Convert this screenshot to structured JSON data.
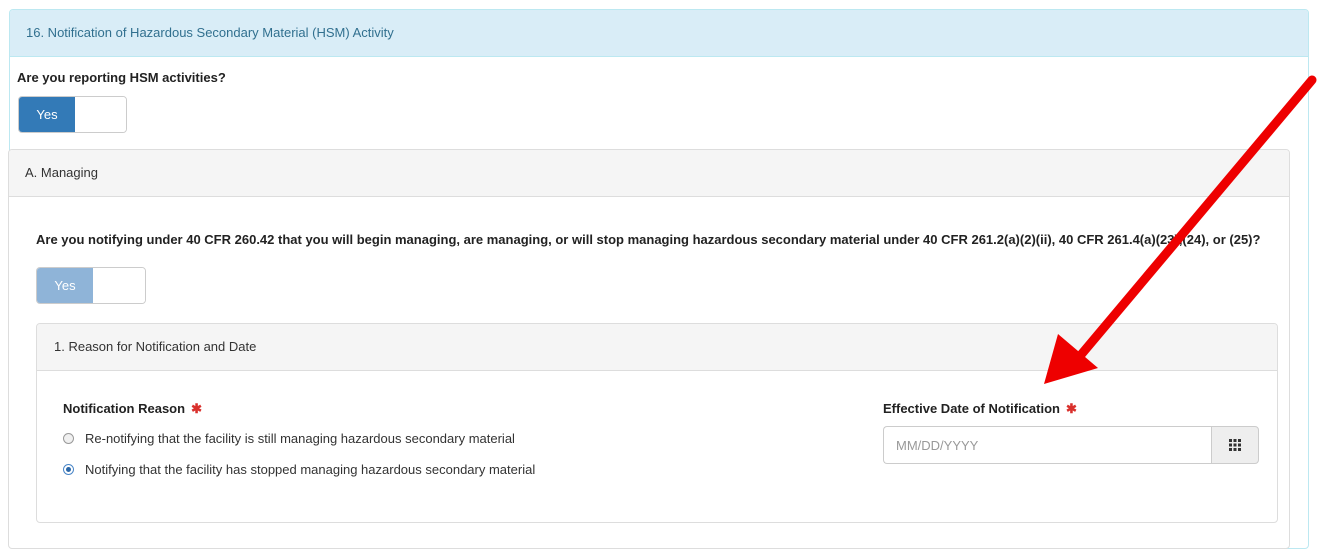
{
  "outer_panel": {
    "title": "16. Notification of Hazardous Secondary Material (HSM) Activity"
  },
  "hsm_question": {
    "text": "Are you reporting HSM activities?",
    "toggle_label": "Yes"
  },
  "managing_panel": {
    "title": "A. Managing",
    "question": "Are you notifying under 40 CFR 260.42 that you will begin managing, are managing, or will stop managing hazardous secondary material under 40 CFR 261.2(a)(2)(ii), 40 CFR 261.4(a)(23),(24), or (25)?",
    "toggle_label": "Yes"
  },
  "reason_panel": {
    "title": "1. Reason for Notification and Date",
    "reason_label": "Notification Reason",
    "required_marker": "✱",
    "options": [
      {
        "label": "Re-notifying that the facility is still managing hazardous secondary material",
        "checked": false
      },
      {
        "label": "Notifying that the facility has stopped managing hazardous secondary material",
        "checked": true
      }
    ],
    "date_label": "Effective Date of Notification",
    "date_placeholder": "MM/DD/YYYY",
    "date_value": ""
  },
  "icons": {
    "calendar_button": "calendar-grid-icon",
    "required": "asterisk-icon",
    "annotation": "red-arrow-icon"
  },
  "colors": {
    "primary": "#337ab7",
    "primary_disabled": "#8fb4d8",
    "info_heading_bg": "#d9edf7",
    "required": "#d9302c",
    "annotation_arrow": "#ee0000"
  }
}
